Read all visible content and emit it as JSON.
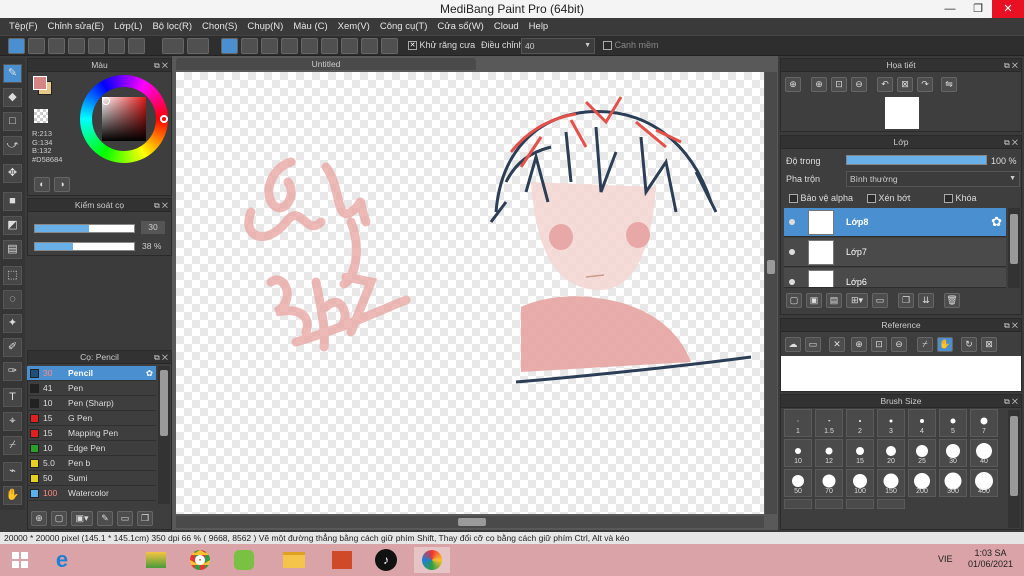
{
  "window": {
    "title": "MediBang Paint Pro (64bit)",
    "min": "—",
    "max": "❐",
    "close": "✕"
  },
  "menu": [
    "Tệp(F)",
    "Chỉnh sửa(E)",
    "Lớp(L)",
    "Bộ lọc(R)",
    "Chọn(S)",
    "Chụp(N)",
    "Màu (C)",
    "Xem(V)",
    "Công cụ(T)",
    "Cửa sổ(W)",
    "Cloud",
    "Help"
  ],
  "toolbar": {
    "antialias_label": "Khử răng cưa",
    "adjust_label": "Điều chỉnh",
    "adjust_value": "40",
    "edge_label": "Canh mềm"
  },
  "color_panel": {
    "title": "Màu",
    "rgb": [
      "R:213",
      "G:134",
      "B:132"
    ],
    "hex": "#D58684",
    "primary": "#D58684",
    "secondary": "#E8C98A"
  },
  "brush_control": {
    "title": "Kiểm soát cọ",
    "size_value": "30",
    "opacity_value": "38 %",
    "size_fraction": 0.55,
    "opacity_fraction": 0.38
  },
  "brush_panel": {
    "title": "Cọ: Pencil",
    "items": [
      {
        "size": "30",
        "name": "Pencil",
        "color": "#1f4e79"
      },
      {
        "size": "41",
        "name": "Pen",
        "color": "#222222"
      },
      {
        "size": "10",
        "name": "Pen (Sharp)",
        "color": "#222222"
      },
      {
        "size": "15",
        "name": "G Pen",
        "color": "#e02020"
      },
      {
        "size": "15",
        "name": "Mapping Pen",
        "color": "#e02020"
      },
      {
        "size": "10",
        "name": "Edge Pen",
        "color": "#2aa02a"
      },
      {
        "size": "5.0",
        "name": " Pen b",
        "color": "#e8d020"
      },
      {
        "size": "50",
        "name": "Sumi",
        "color": "#e8d020"
      },
      {
        "size": "100",
        "name": "Watercolor",
        "color": "#5ab0e8"
      }
    ]
  },
  "document": {
    "tab": "Untitled"
  },
  "navigator": {
    "title": "Họa tiết"
  },
  "layer_panel": {
    "title": "Lớp",
    "opacity_label": "Độ trong",
    "opacity_value": "100 %",
    "opacity_fraction": 1.0,
    "blend_label": "Pha trộn",
    "blend_value": "Bình thường",
    "protect_alpha": "Bảo vệ alpha",
    "clipping": "Xén bớt",
    "lock": "Khóa",
    "layers": [
      "Lớp8",
      "Lớp7",
      "Lớp6"
    ]
  },
  "reference": {
    "title": "Reference"
  },
  "brush_size": {
    "title": "Brush Size",
    "sizes": [
      "1",
      "1.5",
      "2",
      "3",
      "4",
      "5",
      "7",
      "10",
      "12",
      "15",
      "20",
      "25",
      "30",
      "40",
      "50",
      "70",
      "100",
      "150",
      "200",
      "300",
      "400",
      "",
      "",
      "",
      ""
    ]
  },
  "status": {
    "text": "20000 * 20000 pixel   (145.1 * 145.1cm)   350 dpi   66 %   ( 9668, 8562 )   Vẽ một đường thẳng bằng cách giữ phím Shift, Thay đổi cỡ cọ bằng cách giữ phím Ctrl, Alt và kéo"
  },
  "taskbar": {
    "lang": "VIE",
    "time": "1:03 SA",
    "date": "01/06/2021"
  }
}
